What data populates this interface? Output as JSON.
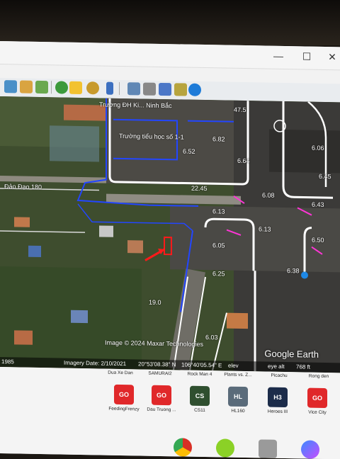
{
  "window": {
    "minimize_glyph": "—",
    "maximize_glyph": "☐",
    "close_glyph": "✕"
  },
  "map": {
    "labels": [
      {
        "text": "Trường ĐH Ki... Ninh Bắc",
        "kind": "place"
      },
      {
        "text": "Trường tiểu học số 1-1",
        "kind": "place"
      },
      {
        "text": "Đảo Đạo 180",
        "kind": "place"
      },
      {
        "text": "47.5",
        "kind": "measure"
      },
      {
        "text": "6.52",
        "kind": "measure"
      },
      {
        "text": "6.82",
        "kind": "measure"
      },
      {
        "text": "6.64",
        "kind": "measure"
      },
      {
        "text": "22.45",
        "kind": "measure"
      },
      {
        "text": "6.13",
        "kind": "measure"
      },
      {
        "text": "6.08",
        "kind": "measure"
      },
      {
        "text": "6.13",
        "kind": "measure"
      },
      {
        "text": "19.0",
        "kind": "measure"
      },
      {
        "text": "6.45",
        "kind": "measure"
      },
      {
        "text": "6.05",
        "kind": "measure"
      },
      {
        "text": "6.38",
        "kind": "measure"
      },
      {
        "text": "6.06",
        "kind": "measure"
      },
      {
        "text": "6.25",
        "kind": "measure"
      },
      {
        "text": "6.50",
        "kind": "measure"
      },
      {
        "text": "6.03",
        "kind": "measure"
      },
      {
        "text": "6.43",
        "kind": "measure"
      }
    ],
    "attribution": "Image © 2024 Maxar Technologies",
    "logo": "Google Earth",
    "status": {
      "year": "1985",
      "imagery_date": "Imagery Date: 2/10/2021",
      "lat": "20°53'08.38\" N",
      "lon": "106°40'05.54\" E",
      "elev": "elev",
      "eye": "eye alt",
      "alt": "768 ft"
    }
  },
  "desktop": {
    "top_labels": [
      "Dua Xe Dan",
      "SAMURAI2",
      "Rock Man 4",
      "Plants vs. Z...",
      "Picachu",
      "Rong den"
    ],
    "icons": [
      {
        "label": "FeedingFrenzy",
        "glyph": "GO",
        "color": "#e0282a",
        "icon": "game-icon"
      },
      {
        "label": "Dau Truong ...",
        "glyph": "GO",
        "color": "#e0282a",
        "icon": "game-icon"
      },
      {
        "label": "CS11",
        "glyph": "CS",
        "color": "#2f4f2f",
        "icon": "game-icon"
      },
      {
        "label": "HL160",
        "glyph": "HL",
        "color": "#5a6b7a",
        "icon": "game-icon"
      },
      {
        "label": "Heroes III",
        "glyph": "H3",
        "color": "#1c2c4a",
        "icon": "game-icon"
      },
      {
        "label": "Vice City",
        "glyph": "GO",
        "color": "#e0282a",
        "icon": "game-icon"
      }
    ]
  },
  "taskbar": [
    {
      "icon": "chrome-icon",
      "color": "#d93025"
    },
    {
      "icon": "four-icon",
      "color": "#8bd126"
    },
    {
      "icon": "apps-icon",
      "color": "#9a9a9a"
    },
    {
      "icon": "messenger-icon",
      "color": "#5b6cff"
    }
  ],
  "colors": {
    "boundary_blue": "#2346ff",
    "boundary_white": "#ffffff",
    "marker_magenta": "#ff35d6",
    "arrow_red": "#ff1a1a"
  }
}
